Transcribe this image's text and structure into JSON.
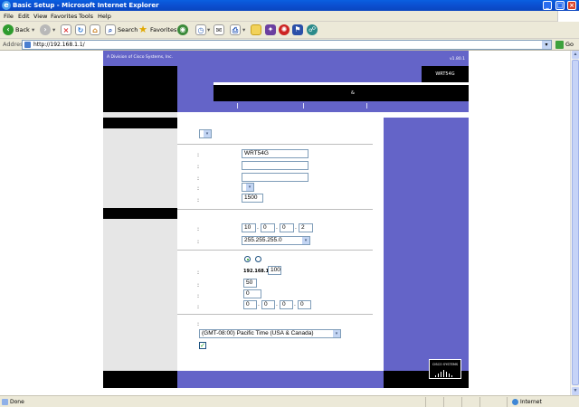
{
  "window": {
    "title": "Basic Setup - Microsoft Internet Explorer",
    "min_glyph": "_",
    "max_glyph": "□",
    "close_glyph": "×"
  },
  "menu": [
    "File",
    "Edit",
    "View",
    "Favorites",
    "Tools",
    "Help"
  ],
  "toolbar": {
    "back_label": "Back",
    "search_label": "Search",
    "favorites_label": "Favorites"
  },
  "address": {
    "label": "Address",
    "url": "http://192.168.1.1/",
    "go_label": "Go"
  },
  "router": {
    "division_text": "A Division of Cisco Systems, Inc.",
    "version_text": "v1.80.1",
    "model": "WRT54G",
    "header_glyph": "&",
    "cisco_logo_text": "CISCO SYSTEMS"
  },
  "form": {
    "internet_connection_type": "",
    "router_name": "WRT54G",
    "host_name": "",
    "domain_name": "",
    "mtu_mode": "",
    "mtu_size": "1500",
    "local_ip": [
      "10",
      "0",
      "0",
      "2"
    ],
    "subnet_mask": "255.255.255.0",
    "dhcp_enabled": true,
    "dhcp_start_prefix": "192.168.1.",
    "dhcp_start_last": "100",
    "max_dhcp_users": "50",
    "client_lease_time": "0",
    "static_dns": [
      "0",
      "0",
      "0",
      "0"
    ],
    "time_zone": "(GMT-08:00) Pacific Time (USA & Canada)",
    "auto_dst": true
  },
  "status": {
    "text": "Done",
    "zone": "Internet"
  },
  "colors": {
    "linksys_purple": "#6464c8",
    "xp_blue": "#0b4fd0",
    "chrome": "#ece9d8"
  }
}
